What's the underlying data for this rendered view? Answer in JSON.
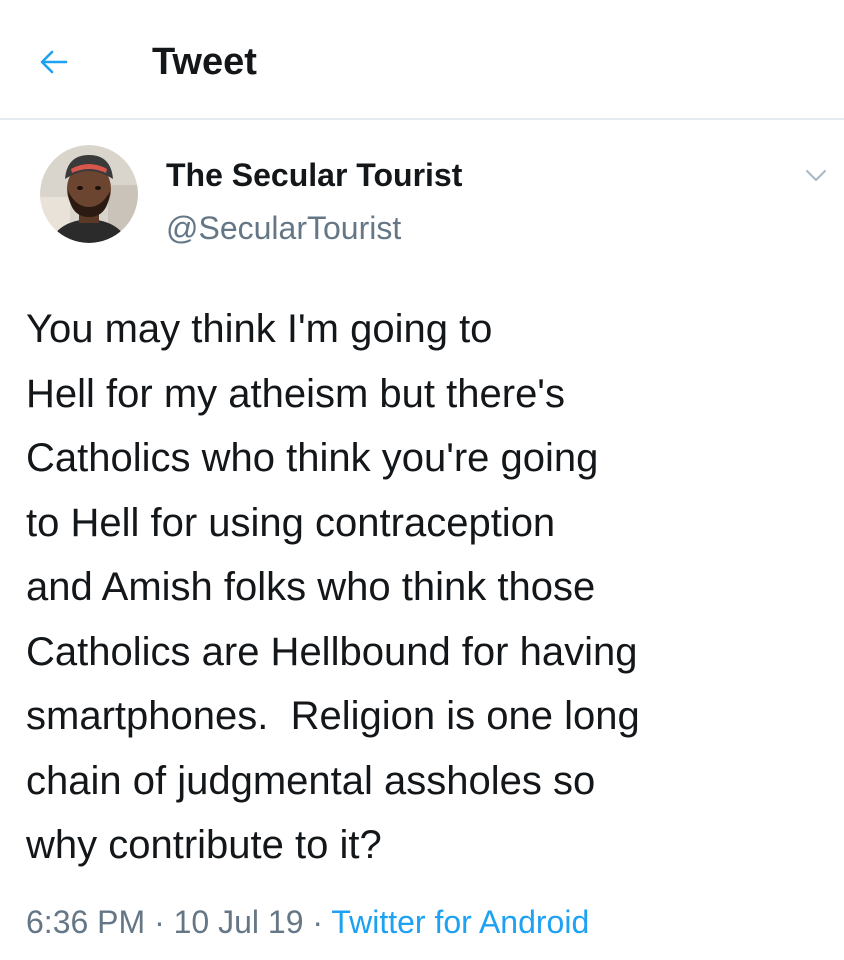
{
  "header": {
    "title": "Tweet"
  },
  "tweet": {
    "display_name": "The Secular Tourist",
    "handle": "@SecularTourist",
    "text_lines": [
      "You may think I'm going to",
      "Hell for my atheism but there's",
      "Catholics who think you're going",
      "to Hell for using contraception",
      "and Amish folks who think those",
      "Catholics are Hellbound for having",
      "smartphones.  Religion is one long",
      "chain of judgmental assholes so",
      "why contribute to it?"
    ],
    "time": "6:36 PM",
    "separator": " · ",
    "date": "10 Jul 19",
    "source": "Twitter for Android"
  },
  "colors": {
    "accent": "#1da1f2",
    "text": "#14171a",
    "secondary": "#657786",
    "divider": "#e6ecf0"
  },
  "icons": {
    "back": "arrow-left-icon",
    "caret": "chevron-down-icon",
    "avatar": "profile-photo"
  }
}
